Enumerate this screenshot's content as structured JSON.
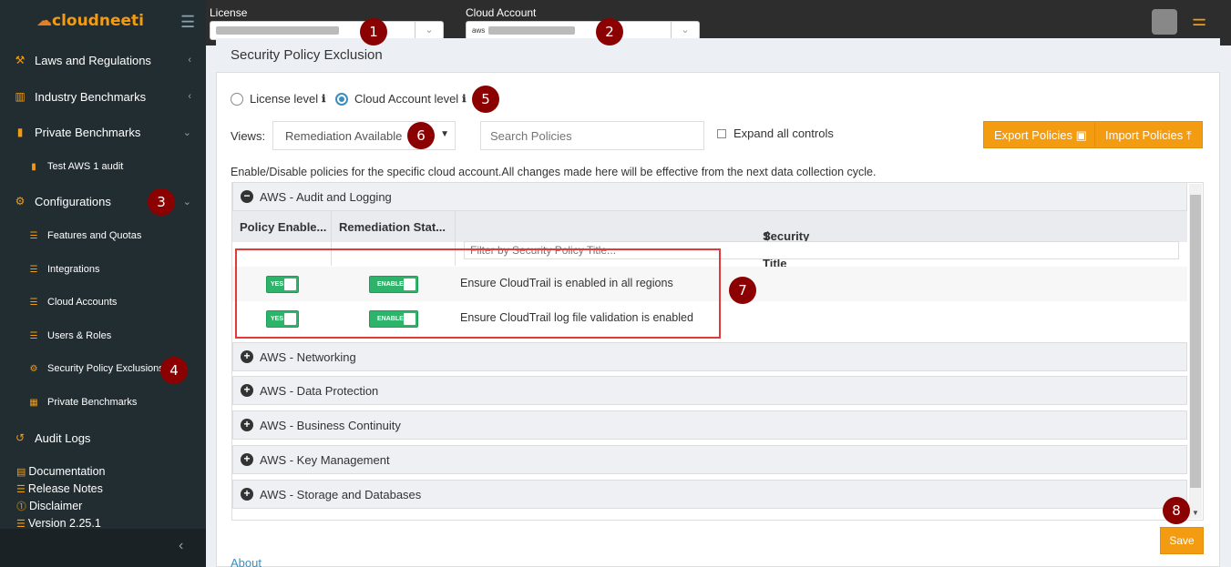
{
  "sidebar": {
    "logo": "cloudneeti",
    "items": [
      {
        "label": "Laws and Regulations",
        "icon": "gavel-icon"
      },
      {
        "label": "Industry Benchmarks",
        "icon": "bank-icon"
      },
      {
        "label": "Private Benchmarks",
        "icon": "bar-chart-icon"
      },
      {
        "label": "Test AWS 1 audit",
        "icon": "bar-chart-icon"
      },
      {
        "label": "Configurations",
        "icon": "gear-icon"
      },
      {
        "label": "Features and Quotas",
        "icon": "list-icon"
      },
      {
        "label": "Integrations",
        "icon": "list-icon"
      },
      {
        "label": "Cloud Accounts",
        "icon": "list-icon"
      },
      {
        "label": "Users & Roles",
        "icon": "list-icon"
      },
      {
        "label": "Security Policy Exclusions",
        "icon": "gears-icon"
      },
      {
        "label": "Private Benchmarks",
        "icon": "table-icon"
      },
      {
        "label": "Audit Logs",
        "icon": "history-icon"
      }
    ],
    "links": [
      "Documentation",
      "Release Notes",
      "Disclaimer",
      "Version 2.25.1"
    ]
  },
  "topbar": {
    "license_label": "License",
    "cloud_account_label": "Cloud Account",
    "aws_tag": "aws"
  },
  "badges": [
    "1",
    "2",
    "3",
    "4",
    "5",
    "6",
    "7",
    "8"
  ],
  "main": {
    "title": "Security Policy Exclusion",
    "radio_license": "License level",
    "radio_cloud": "Cloud Account level",
    "views_label": "Views:",
    "views_selected": "Remediation Available",
    "search_placeholder": "Search Policies",
    "expand_label": "Expand all controls",
    "export_btn": "Export Policies",
    "import_btn": "Import Policies",
    "note": "Enable/Disable policies for the specific cloud account.All changes made here will be effective from the next data collection cycle.",
    "groups": [
      "AWS - Audit and Logging",
      "AWS - Networking",
      "AWS - Data Protection",
      "AWS - Business Continuity",
      "AWS - Key Management",
      "AWS - Storage and Databases"
    ],
    "columns": [
      "Policy Enable...",
      "Remediation Stat...",
      "Security Policy Title"
    ],
    "filter_placeholder": "Filter by Security Policy Title...",
    "rows": [
      {
        "enabled": "YES",
        "remediation": "ENABLE",
        "title": "Ensure CloudTrail is enabled in all regions"
      },
      {
        "enabled": "YES",
        "remediation": "ENABLE",
        "title": "Ensure CloudTrail log file validation is enabled"
      }
    ],
    "save_btn": "Save",
    "about": "About"
  },
  "colors": {
    "accent": "#f39c12",
    "sidebar": "#222d32",
    "topbar": "#2d2d2d",
    "toggle": "#2eb36b",
    "badge": "#8b0000",
    "highlight": "#e03a3a"
  }
}
